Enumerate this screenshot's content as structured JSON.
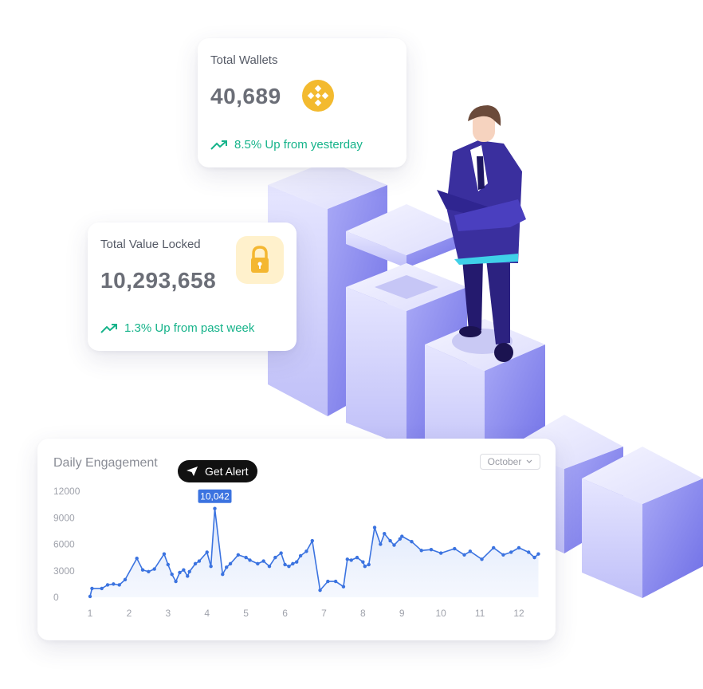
{
  "colors": {
    "trend_green": "#16b38a",
    "chart_line": "#3b73e0",
    "coin_yellow": "#f3ba2f",
    "lock_orange": "#f4b731",
    "block_purple": "#8c8cf0",
    "suit_navy": "#2a1f7a"
  },
  "wallets_card": {
    "label": "Total Wallets",
    "value": "40,689",
    "icon": "binance-coin-icon",
    "trend_icon": "trend-up-icon",
    "trend_text": "8.5% Up from yesterday"
  },
  "tvl_card": {
    "label": "Total Value Locked",
    "value": "10,293,658",
    "icon": "lock-icon",
    "trend_icon": "trend-up-icon",
    "trend_text": "1.3% Up from past week"
  },
  "engagement": {
    "title": "Daily Engagement",
    "alert_button": "Get Alert",
    "alert_icon": "send-icon",
    "month_select": "October",
    "peak_label": "10,042"
  },
  "chart_data": {
    "type": "area",
    "title": "Daily Engagement",
    "yticks": [
      "12000",
      "9000",
      "6000",
      "3000",
      "0"
    ],
    "xticks": [
      "1",
      "2",
      "3",
      "4",
      "5",
      "6",
      "7",
      "8",
      "9",
      "10",
      "11",
      "12"
    ],
    "ylim": [
      0,
      12000
    ],
    "xlim": [
      1,
      12.5
    ],
    "grid": false,
    "highlight": {
      "x": 4.2,
      "y": 10042,
      "label": "10,042"
    },
    "x": [
      1,
      1.05,
      1.3,
      1.45,
      1.6,
      1.75,
      1.9,
      2.2,
      2.35,
      2.5,
      2.65,
      2.9,
      3.0,
      3.1,
      3.2,
      3.3,
      3.4,
      3.5,
      3.55,
      3.7,
      3.8,
      4.0,
      4.1,
      4.2,
      4.4,
      4.5,
      4.6,
      4.8,
      5.0,
      5.1,
      5.3,
      5.45,
      5.6,
      5.75,
      5.9,
      6.0,
      6.1,
      6.2,
      6.3,
      6.4,
      6.55,
      6.7,
      6.9,
      7.1,
      7.3,
      7.5,
      7.6,
      7.7,
      7.85,
      8.0,
      8.05,
      8.15,
      8.3,
      8.45,
      8.55,
      8.7,
      8.8,
      8.95,
      9.0,
      9.25,
      9.5,
      9.75,
      10.0,
      10.35,
      10.6,
      10.75,
      11.05,
      11.35,
      11.6,
      11.8,
      12.0,
      12.25,
      12.4,
      12.5
    ],
    "series": [
      {
        "values": [
          100,
          1000,
          1000,
          1400,
          1500,
          1400,
          2000,
          4400,
          3100,
          2900,
          3200,
          4900,
          3700,
          2600,
          1800,
          2800,
          3100,
          2400,
          2900,
          3800,
          4100,
          5100,
          3500,
          10042,
          2600,
          3400,
          3800,
          4800,
          4500,
          4200,
          3800,
          4100,
          3500,
          4500,
          5000,
          3700,
          3500,
          3800,
          4000,
          4700,
          5200,
          6400,
          800,
          1800,
          1800,
          1200,
          4300,
          4200,
          4500,
          4000,
          3500,
          3700,
          7900,
          6000,
          7200,
          6400,
          5900,
          6600,
          6900,
          6300,
          5300,
          5400,
          5000,
          5500,
          4800,
          5200,
          4300,
          5600,
          4800,
          5100,
          5600,
          5100,
          4500,
          4900
        ]
      }
    ]
  }
}
